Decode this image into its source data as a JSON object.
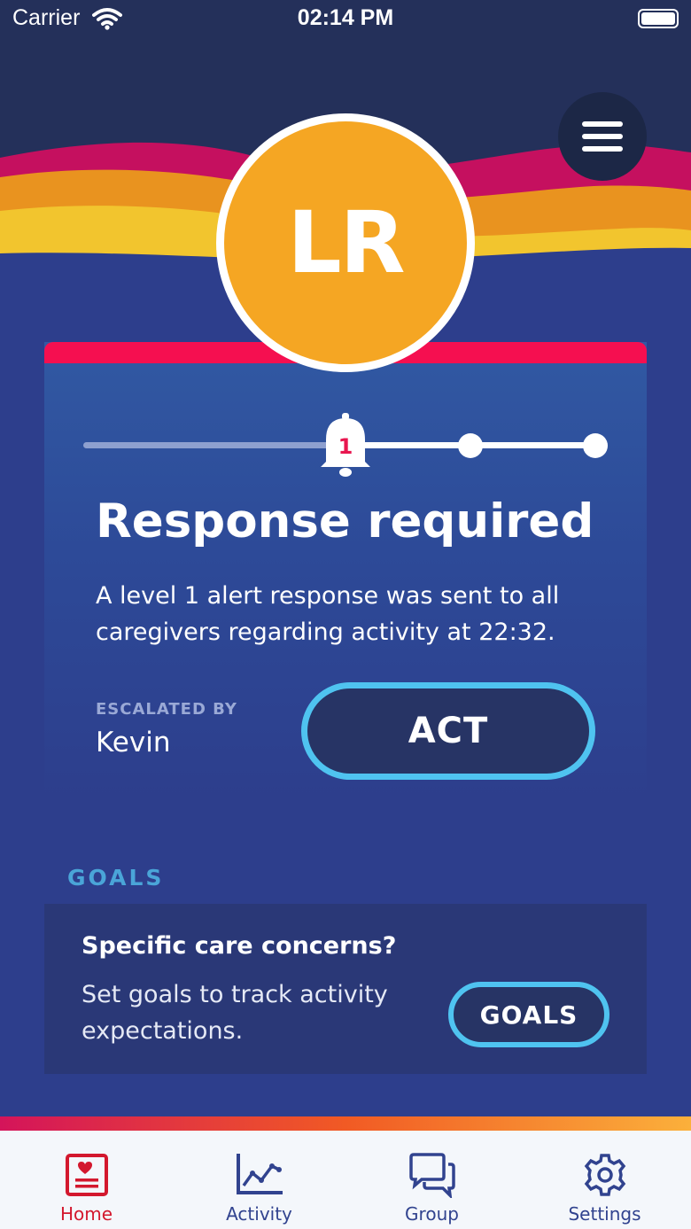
{
  "status_bar": {
    "carrier": "Carrier",
    "time": "02:14 PM"
  },
  "header": {
    "menu_icon": "hamburger-menu-icon"
  },
  "profile": {
    "initials": "LR",
    "avatar_color": "#f5a623"
  },
  "alert_card": {
    "accent_color": "#f50f50",
    "alert_level": "1",
    "progress_steps_total": 4,
    "progress_current_step": 2,
    "title": "Response required",
    "description": "A level 1 alert response was sent to all caregivers regarding activity at 22:32.",
    "escalated_label": "ESCALATED BY",
    "escalated_name": "Kevin",
    "act_label": "ACT"
  },
  "goals": {
    "heading": "GOALS",
    "title": "Specific care concerns?",
    "description": "Set goals to track activity expectations.",
    "button_label": "GOALS"
  },
  "tabbar": {
    "active_color": "#d3182e",
    "items": [
      {
        "label": "Home",
        "icon": "home-card-heart-icon"
      },
      {
        "label": "Activity",
        "icon": "activity-chart-icon"
      },
      {
        "label": "Group",
        "icon": "group-chat-icon"
      },
      {
        "label": "Settings",
        "icon": "gear-icon"
      }
    ]
  }
}
